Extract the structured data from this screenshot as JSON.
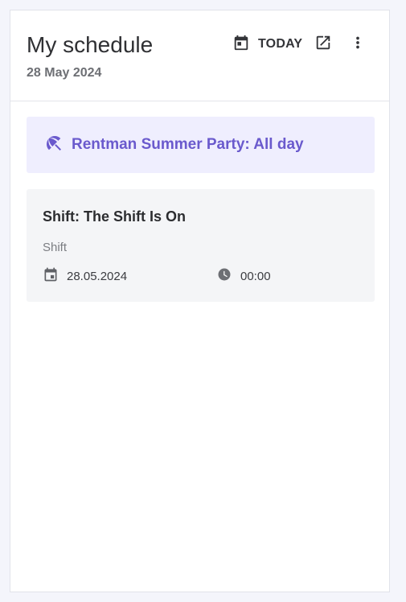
{
  "header": {
    "title": "My schedule",
    "date": "28 May 2024",
    "today_label": "TODAY"
  },
  "event_banner": {
    "text": "Rentman Summer Party: All day",
    "icon": "beach-umbrella-icon",
    "color": "#6a5acd",
    "background": "#efeefe"
  },
  "shift": {
    "title": "Shift: The Shift Is On",
    "type": "Shift",
    "date": "28.05.2024",
    "time": "00:00"
  },
  "icons": {
    "calendar": "calendar-icon",
    "open_external": "open-in-new-icon",
    "more": "more-vertical-icon",
    "clock": "clock-icon"
  }
}
